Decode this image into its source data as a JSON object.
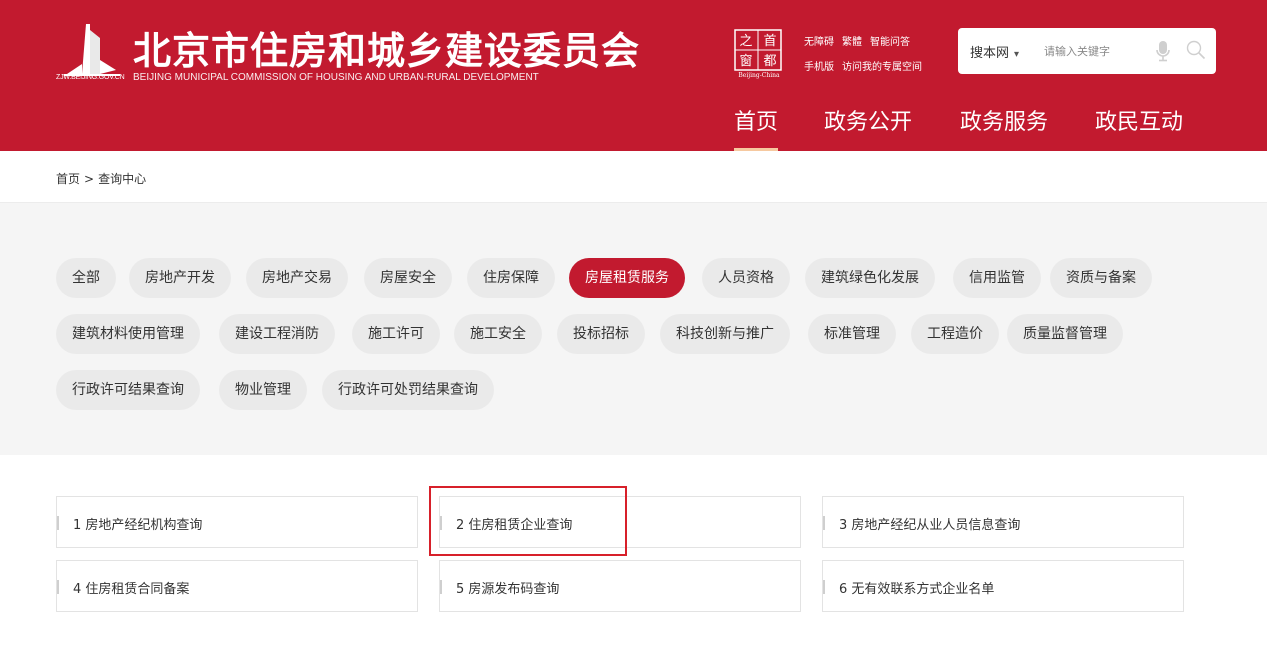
{
  "header": {
    "site_title": "北京市住房和城乡建设委员会",
    "site_subtitle": "BEIJING MUNICIPAL COMMISSION OF HOUSING AND URBAN-RURAL DEVELOPMENT",
    "logo_url_text": "ZJW.BEIJING.GOV.CN",
    "capital_logo_chars": [
      "之",
      "首",
      "窗",
      "都"
    ],
    "capital_caption": "Beijing-China",
    "util_links_row1": [
      "无障碍",
      "繁體",
      "智能问答"
    ],
    "util_links_row2": [
      "手机版",
      "访问我的专属空间"
    ],
    "search": {
      "scope": "搜本网",
      "placeholder": "请输入关键字"
    },
    "brand_color": "#c21a2f"
  },
  "main_nav": [
    {
      "label": "首页",
      "active": true
    },
    {
      "label": "政务公开"
    },
    {
      "label": "政务服务"
    },
    {
      "label": "政民互动"
    }
  ],
  "breadcrumb": {
    "home": "首页",
    "separator": ">",
    "current": "查询中心"
  },
  "categories": [
    {
      "label": "全部"
    },
    {
      "label": "房地产开发"
    },
    {
      "label": "房地产交易"
    },
    {
      "label": "房屋安全"
    },
    {
      "label": "住房保障"
    },
    {
      "label": "房屋租赁服务",
      "active": true
    },
    {
      "label": "人员资格"
    },
    {
      "label": "建筑绿色化发展"
    },
    {
      "label": "信用监管"
    },
    {
      "label": "资质与备案"
    },
    {
      "label": "建筑材料使用管理"
    },
    {
      "label": "建设工程消防"
    },
    {
      "label": "施工许可"
    },
    {
      "label": "施工安全"
    },
    {
      "label": "投标招标"
    },
    {
      "label": "科技创新与推广"
    },
    {
      "label": "标准管理"
    },
    {
      "label": "工程造价"
    },
    {
      "label": "质量监督管理"
    },
    {
      "label": "行政许可结果查询"
    },
    {
      "label": "物业管理"
    },
    {
      "label": "行政许可处罚结果查询"
    }
  ],
  "results": [
    {
      "label": "1 房地产经纪机构查询"
    },
    {
      "label": "2 住房租赁企业查询",
      "highlighted": true
    },
    {
      "label": "3 房地产经纪从业人员信息查询"
    },
    {
      "label": "4 住房租赁合同备案"
    },
    {
      "label": "5 房源发布码查询"
    },
    {
      "label": "6 无有效联系方式企业名单"
    }
  ]
}
